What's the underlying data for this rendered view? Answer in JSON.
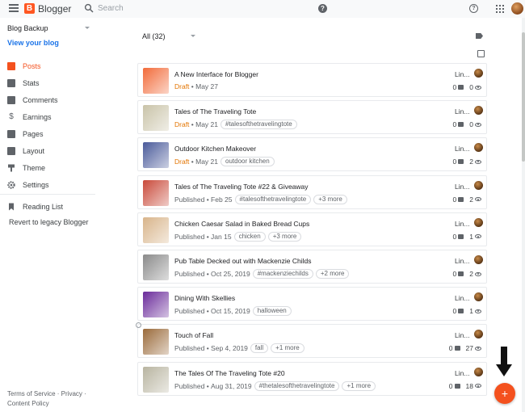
{
  "header": {
    "app_name": "Blogger",
    "search_placeholder": "Search"
  },
  "sidebar": {
    "blog_name": "Blog Backup",
    "view_blog": "View your blog",
    "items": [
      {
        "label": "Posts",
        "icon": "posts-icon",
        "active": true
      },
      {
        "label": "Stats",
        "icon": "stats-icon"
      },
      {
        "label": "Comments",
        "icon": "comments-icon"
      },
      {
        "label": "Earnings",
        "icon": "dollar-icon"
      },
      {
        "label": "Pages",
        "icon": "pages-icon"
      },
      {
        "label": "Layout",
        "icon": "layout-icon"
      },
      {
        "label": "Theme",
        "icon": "theme-icon"
      },
      {
        "label": "Settings",
        "icon": "gear-icon"
      }
    ],
    "reading_list": "Reading List",
    "revert": "Revert to legacy Blogger",
    "footer": "Terms of Service · Privacy · Content Policy"
  },
  "filter": {
    "label": "All (32)"
  },
  "posts": [
    {
      "title": "A New Interface for Blogger",
      "status": "Draft",
      "date": "May 27",
      "labels": [],
      "author": "Lin...",
      "comments": "0",
      "views": "0",
      "thumb_color": "#f26b3a"
    },
    {
      "title": "Tales of The Traveling Tote",
      "status": "Draft",
      "date": "May 21",
      "labels": [
        "#talesofthetravelingtote"
      ],
      "author": "Lin...",
      "comments": "0",
      "views": "0",
      "thumb_color": "#c9c3a8"
    },
    {
      "title": "Outdoor Kitchen Makeover",
      "status": "Draft",
      "date": "May 21",
      "labels": [
        "outdoor kitchen"
      ],
      "author": "Lin...",
      "comments": "0",
      "views": "2",
      "thumb_color": "#4a5a9a"
    },
    {
      "title": "Tales of The Traveling Tote #22 & Giveaway",
      "status": "Published",
      "date": "Feb 25",
      "labels": [
        "#talesofthetravelingtote",
        "+3 more"
      ],
      "author": "Lin...",
      "comments": "0",
      "views": "2",
      "thumb_color": "#c94a3a"
    },
    {
      "title": "Chicken Caesar Salad in Baked Bread Cups",
      "status": "Published",
      "date": "Jan 15",
      "labels": [
        "chicken",
        "+3 more"
      ],
      "author": "Lin...",
      "comments": "0",
      "views": "1",
      "thumb_color": "#d8b48a"
    },
    {
      "title": "Pub Table Decked out with Mackenzie Childs",
      "status": "Published",
      "date": "Oct 25, 2019",
      "labels": [
        "#mackenziechilds",
        "+2 more"
      ],
      "author": "Lin...",
      "comments": "0",
      "views": "2",
      "thumb_color": "#8a8a8a"
    },
    {
      "title": "Dining With Skellies",
      "status": "Published",
      "date": "Oct 15, 2019",
      "labels": [
        "halloween"
      ],
      "author": "Lin...",
      "comments": "0",
      "views": "1",
      "thumb_color": "#6a2a9a"
    },
    {
      "title": "Touch of Fall",
      "status": "Published",
      "date": "Sep 4, 2019",
      "labels": [
        "fall",
        "+1 more"
      ],
      "author": "Lin...",
      "comments": "0",
      "views": "27",
      "thumb_color": "#9a6a3a"
    },
    {
      "title": "The Tales Of The Traveling Tote #20",
      "status": "Published",
      "date": "Aug 31, 2019",
      "labels": [
        "#thetalesofthetravelingtote",
        "+1 more"
      ],
      "author": "Lin...",
      "comments": "0",
      "views": "18",
      "thumb_color": "#b8b4a0"
    }
  ],
  "fab": {
    "label": "+"
  },
  "colors": {
    "accent": "#f4511e",
    "link": "#1a73e8",
    "draft": "#e37400"
  }
}
